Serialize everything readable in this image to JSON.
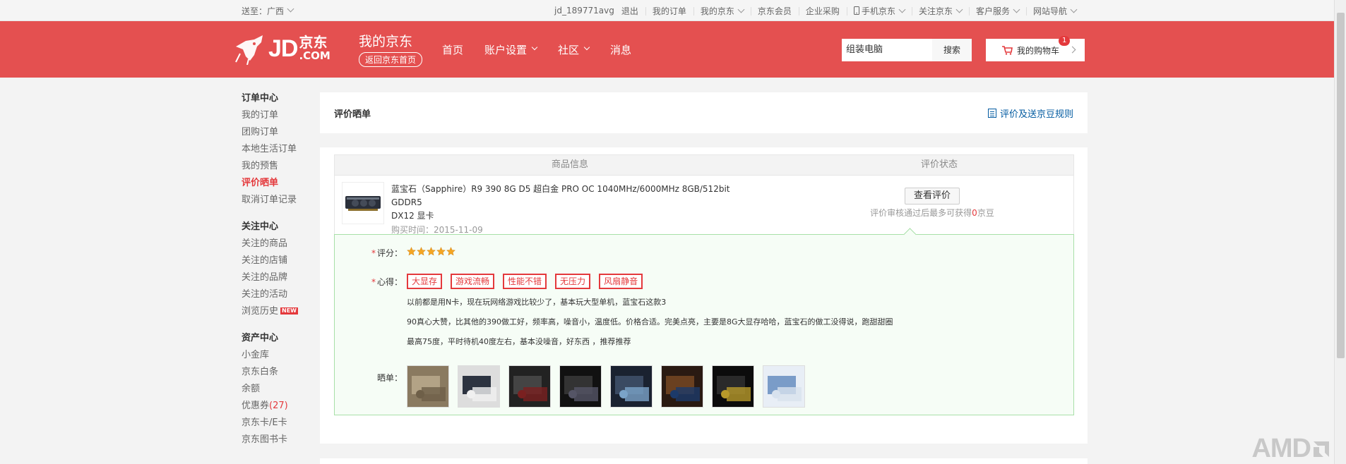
{
  "topbar": {
    "location": "送至：广西",
    "username": "jd_189771avg",
    "logout": "退出",
    "links": [
      "我的订单",
      "我的京东",
      "京东会员",
      "企业采购",
      "手机京东",
      "关注京东",
      "客户服务",
      "网站导航"
    ]
  },
  "header": {
    "logo_jd": "JD",
    "logo_cn": "京东",
    "logo_com": ".COM",
    "title": "我的京东",
    "back_home": "返回京东首页",
    "nav": [
      "首页",
      "账户设置",
      "社区",
      "消息"
    ],
    "search_value": "组装电脑",
    "search_button": "搜索",
    "cart_label": "我的购物车",
    "cart_count": "1"
  },
  "sidebar": {
    "groups": [
      {
        "title": "订单中心",
        "items": [
          "我的订单",
          "团购订单",
          "本地生活订单",
          "我的预售",
          "评价晒单",
          "取消订单记录"
        ]
      },
      {
        "title": "关注中心",
        "items": [
          "关注的商品",
          "关注的店铺",
          "关注的品牌",
          "关注的活动",
          "浏览历史"
        ]
      },
      {
        "title": "资产中心",
        "items": [
          "小金库",
          "京东白条",
          "余额",
          "优惠券",
          "京东卡/E卡",
          "京东图书卡"
        ]
      }
    ],
    "active_item": "评价晒单",
    "new_badge": "NEW",
    "coupon_count": "(27)"
  },
  "main": {
    "title": "评价晒单",
    "rule_link": "评价及送京豆规则",
    "col_product": "商品信息",
    "col_status": "评价状态",
    "product_name_line1": "蓝宝石（Sapphire）R9 390 8G D5 超白金 PRO OC 1040MHz/6000MHz 8GB/512bit GDDR5",
    "product_name_line2": "DX12 显卡",
    "purchase_date": "购买时间：2015-11-09",
    "view_review": "查看评价",
    "tip_before": "评价审核通过后最多可获得",
    "tip_num": "0",
    "tip_after": "京豆",
    "score_label": "评分：",
    "score_value": 5,
    "impress_label": "心得：",
    "tags": [
      "大显存",
      "游戏流畅",
      "性能不错",
      "无压力",
      "风扇静音"
    ],
    "review_lines": [
      "以前都是用N卡，现在玩网络游戏比较少了，基本玩大型单机，蓝宝石这款3",
      "90真心大赞，比其他的390做工好，频率高，噪音小，温度低。价格合适。完美点亮，主要是8G大显存哈哈，蓝宝石的做工没得说，跑甜甜圈",
      "最高75度，平时待机40度左右，基本没噪音，好东西 ，推荐推荐"
    ],
    "photos_label": "晒单：",
    "photo_count": 8
  },
  "watermark": "AMD",
  "colors": {
    "brand_red": "#e45050",
    "accent_red": "#e4393c",
    "link_blue": "#005aa0",
    "star": "#f5a623"
  }
}
